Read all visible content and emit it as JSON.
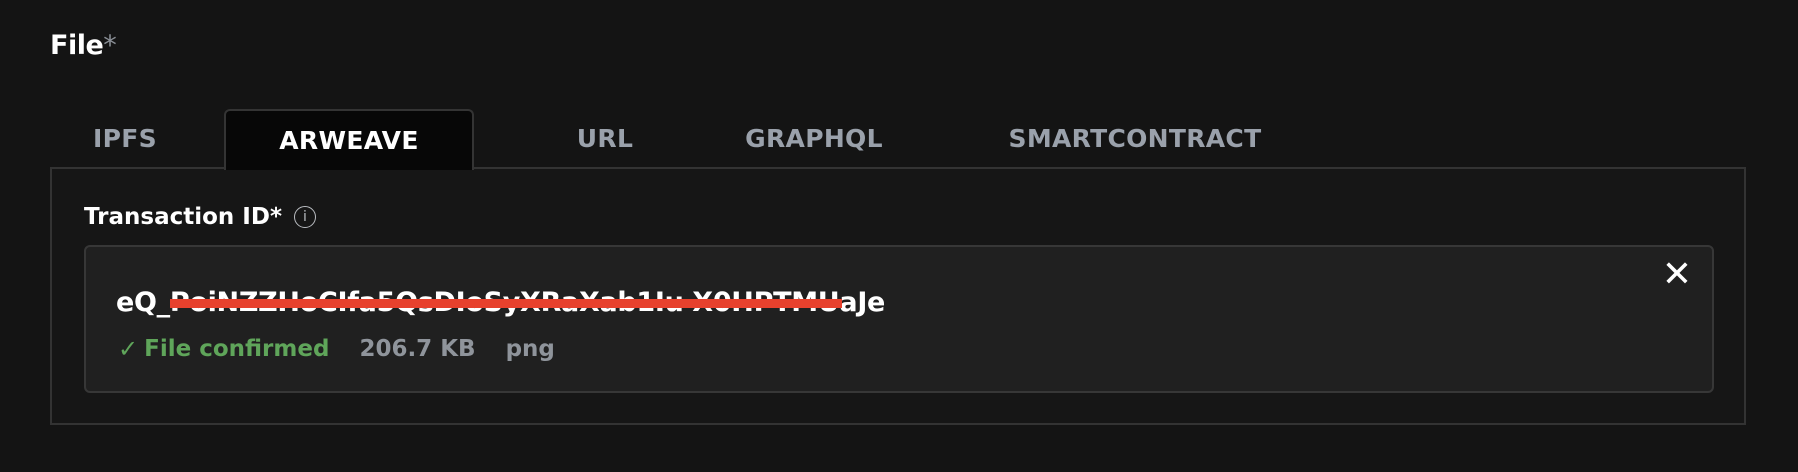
{
  "field": {
    "label": "File",
    "required_mark": "*"
  },
  "tabs": [
    {
      "label": "IPFS",
      "active": false
    },
    {
      "label": "ARWEAVE",
      "active": true
    },
    {
      "label": "URL",
      "active": false
    },
    {
      "label": "GRAPHQL",
      "active": false
    },
    {
      "label": "SMARTCONTRACT",
      "active": false
    }
  ],
  "panel": {
    "label": "Transaction ID*",
    "info_icon": "info-icon",
    "file": {
      "transaction_id": "eQ_PoiNZZHoCIfa5QsDIoSyXRaXab1Iu-X0HPTMUaJe",
      "redacted": true,
      "status": "File confirmed",
      "status_icon": "check-icon",
      "size": "206.7 KB",
      "extension": "png",
      "close_icon": "close-icon"
    }
  },
  "colors": {
    "background": "#141414",
    "status_green": "#5fa55a",
    "redaction": "#e7412d",
    "muted": "#8f949b"
  }
}
